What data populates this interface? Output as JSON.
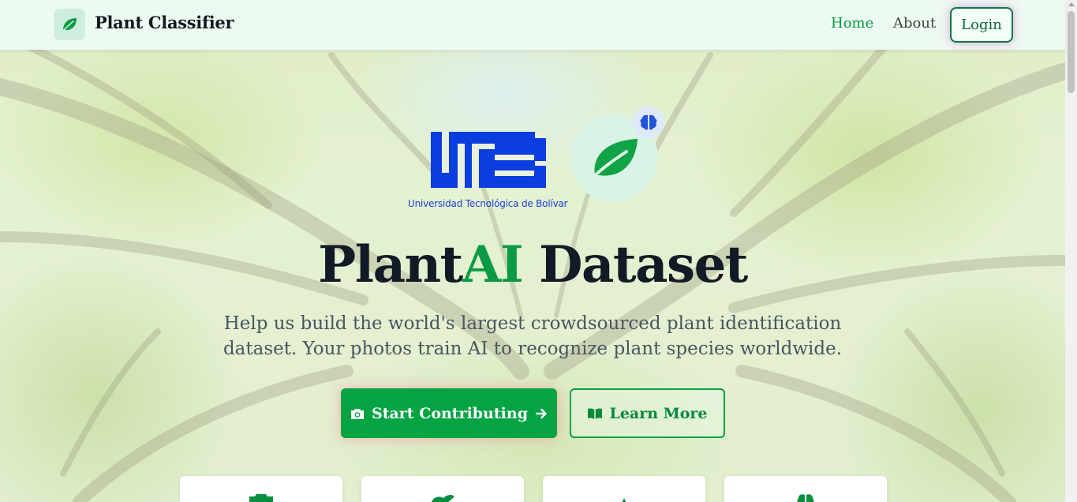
{
  "app": {
    "brand": "Plant Classifier",
    "brand_icon": "leaf-icon"
  },
  "nav": {
    "home": "Home",
    "about": "About",
    "login": "Login",
    "active": "Home"
  },
  "hero": {
    "university_logo_text": "UTB",
    "university_name": "Universidad Tecnológica de Bolívar",
    "title_part1": "Plant",
    "title_accent": "AI",
    "title_part2": " Dataset",
    "subtitle": "Help us build the world's largest crowdsourced plant identification dataset. Your photos train AI to recognize plant species worldwide.",
    "primary_button": "Start Contributing",
    "primary_button_icon": "camera-icon",
    "primary_button_trailing_icon": "arrow-right-icon",
    "secondary_button": "Learn More",
    "secondary_button_icon": "book-open-icon"
  },
  "feature_cards": [
    {
      "icon": "camera-icon"
    },
    {
      "icon": "leaf-icon"
    },
    {
      "icon": "tree-icon"
    },
    {
      "icon": "brain-icon"
    }
  ],
  "colors": {
    "accent_green": "#0a9a46",
    "primary_button_bg": "#05a443",
    "utb_blue": "#1a3fd6",
    "title_dark": "#121a26"
  }
}
